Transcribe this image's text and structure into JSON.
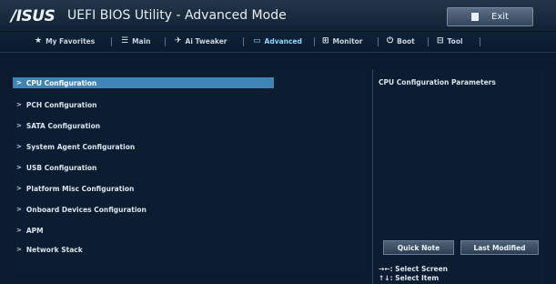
{
  "header": {
    "logo": "/ISUS",
    "title": "UEFI BIOS Utility - Advanced Mode",
    "exit_label": "Exit"
  },
  "tabs": [
    {
      "icon": "★",
      "label": "My Favorites"
    },
    {
      "icon": "☰",
      "label": "Main"
    },
    {
      "icon": "✈",
      "label": "Ai Tweaker"
    },
    {
      "icon": "▭",
      "label": "Advanced",
      "active": true
    },
    {
      "icon": "⊞",
      "label": "Monitor"
    },
    {
      "icon": "⏻",
      "label": "Boot"
    },
    {
      "icon": "⊟",
      "label": "Tool"
    }
  ],
  "menu": [
    {
      "label": "CPU Configuration",
      "selected": true
    },
    {
      "label": "PCH Configuration"
    },
    {
      "label": "SATA Configuration"
    },
    {
      "label": "System Agent Configuration"
    },
    {
      "label": "USB Configuration"
    },
    {
      "label": "Platform Misc Configuration"
    },
    {
      "label": "Onboard Devices Configuration"
    },
    {
      "label": "APM"
    },
    {
      "label": "Network Stack"
    }
  ],
  "right_panel": {
    "title": "CPU Configuration Parameters",
    "quick_note": "Quick Note",
    "last_modified": "Last Modified",
    "help": [
      "→←: Select Screen",
      "↑↓: Select Item"
    ]
  },
  "colors": {
    "selection": "#3f86b6",
    "accent": "#8fd7ff"
  }
}
